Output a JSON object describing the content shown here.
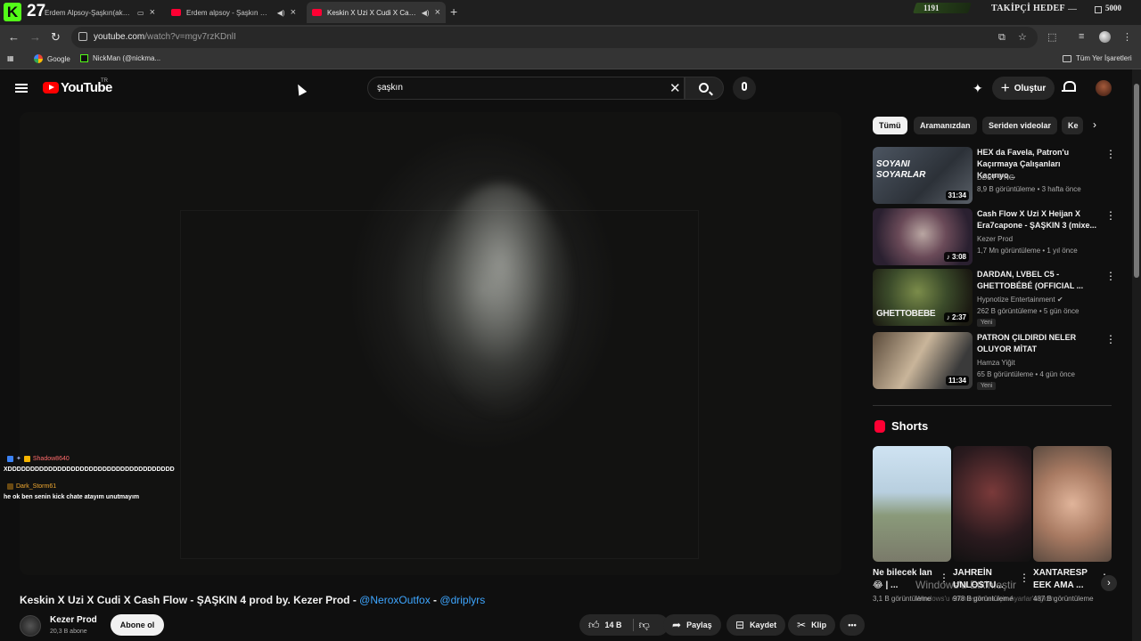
{
  "stream_overlay": {
    "kick_logo": "K",
    "viewer_count": "27",
    "goal_current": "1191",
    "goal_label": "TAKİPÇİ HEDEF",
    "goal_target": "5000"
  },
  "browser": {
    "tabs": [
      {
        "title": "Erdem Alpsoy-Şaşkın(akape",
        "active": false
      },
      {
        "title": "Erdem alpsoy - Şaşkın @er",
        "active": false
      },
      {
        "title": "Keskin X Uzi X Cudi X Cash",
        "active": true
      }
    ],
    "new_tab": "+",
    "url_host": "youtube.com",
    "url_path": "/watch?v=mgv7rzKDnlI",
    "bookmarks": [
      {
        "label": "Google",
        "icon": "google-icon"
      },
      {
        "label": "NickMan (@nickma...",
        "icon": "kick-icon"
      }
    ],
    "all_bookmarks": "Tüm Yer İşaretleri"
  },
  "youtube": {
    "logo_text": "YouTube",
    "region": "TR",
    "search_query": "şaşkın",
    "create_label": "Oluştur"
  },
  "chat": [
    {
      "name": "Shadow8640",
      "name_color": "#ff6b6b",
      "message": "XDDDDDDDDDDDDDDDDDDDDDDDDDDDDDDDDDDDDD"
    },
    {
      "name": "Dark_Storm61",
      "name_color": "#f0a830",
      "message": "he ok ben senin kick chate atayım unutmayım"
    }
  ],
  "video": {
    "title_main": "Keskin X Uzi X Cudi X Cash Flow - ŞAŞKIN 4 prod by. Kezer Prod - ",
    "title_link1": "@NeroxOutfox",
    "title_sep": " - ",
    "title_link2": "@driplyrs",
    "channel": "Kezer Prod",
    "subscribers": "20,3 B abone",
    "subscribe_label": "Abone ol",
    "likes": "14 B",
    "share_label": "Paylaş",
    "save_label": "Kaydet",
    "clip_label": "Klip"
  },
  "chips": [
    "Tümü",
    "Aramanızdan",
    "Seriden videolar",
    "Ke"
  ],
  "recommendations": [
    {
      "title": "HEX da Favela, Patron'u Kaçırmaya Çalışanları Kaçırıyo...",
      "channel": "DDRP PNG",
      "meta": "8,9 B görüntüleme • 3 hafta önce",
      "duration": "31:34",
      "thumb_text": "SOYANI SOYARLAR",
      "is_new": ""
    },
    {
      "title": "Cash Flow X Uzi X Heijan X Era7capone - ŞAŞKIN 3 (mixe...",
      "channel": "Kezer Prod",
      "meta": "1,7 Mn görüntüleme • 1 yıl önce",
      "duration": "♪ 3:08",
      "thumb_text": "",
      "is_new": ""
    },
    {
      "title": "DARDAN, LVBEL C5 - GHETTOBÉBÉ (OFFICIAL ...",
      "channel": "Hypnotize Entertainment ✔",
      "meta": "262 B görüntüleme • 5 gün önce",
      "duration": "♪ 2:37",
      "thumb_text": "GHETTOBEBE",
      "is_new": "Yeni"
    },
    {
      "title": "PATRON ÇILDIRDI NELER OLUYOR MİTAT",
      "channel": "Hamza Yiğit",
      "meta": "65 B görüntüleme • 4 gün önce",
      "duration": "11:34",
      "thumb_text": "",
      "is_new": "Yeni"
    }
  ],
  "shorts": {
    "heading": "Shorts",
    "items": [
      {
        "title": "Ne bilecek lan 😂 | ...",
        "views": "3,1 B görüntüleme"
      },
      {
        "title": "JAHREİN UNLOSTU...",
        "views": "978 B görüntüleme"
      },
      {
        "title": "XANTARESP EEK AMA ...",
        "views": "487 B görüntüleme"
      }
    ]
  },
  "windows_activation": {
    "line1": "Windows'u Etkinleştir",
    "line2": "Windows'u etkinleştirmek için Ayarlar'a gidin."
  }
}
